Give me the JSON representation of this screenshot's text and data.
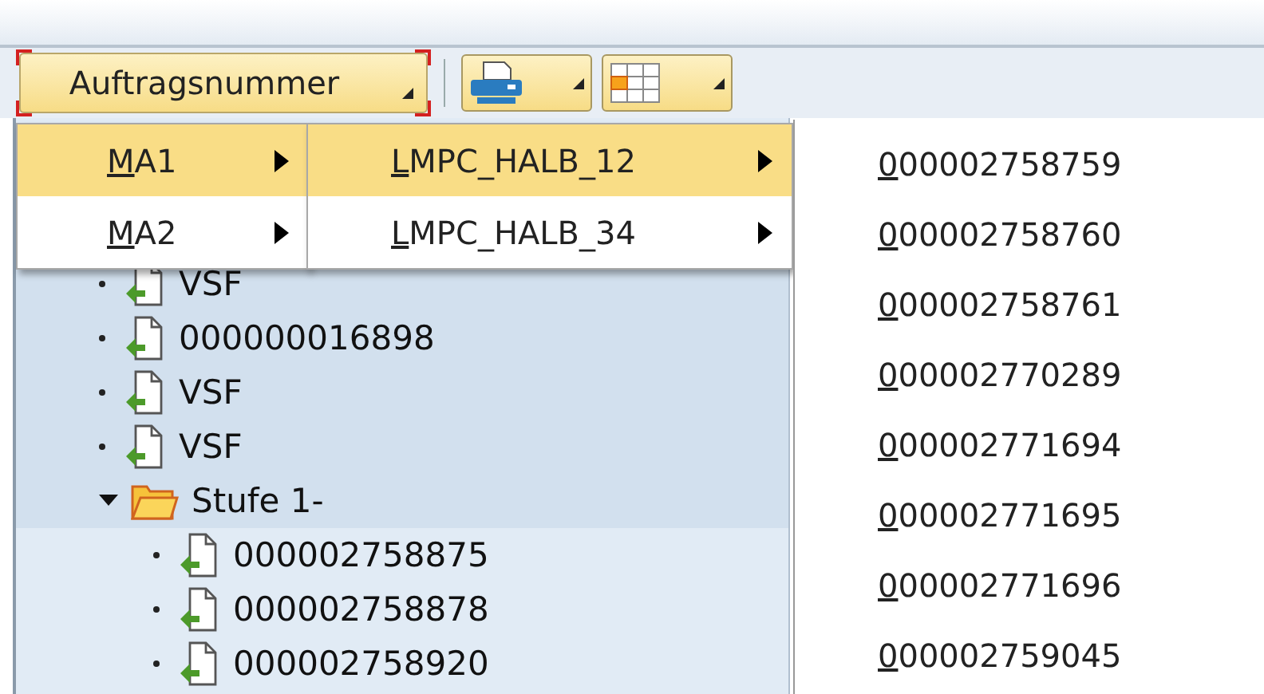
{
  "toolbar": {
    "buttons": [
      {
        "kind": "dropdown",
        "label": "Auftragsnummer",
        "focused": true
      },
      {
        "kind": "print"
      },
      {
        "kind": "layout"
      }
    ]
  },
  "menu": {
    "items": [
      {
        "label": "MA1",
        "selected": true
      },
      {
        "label": "MA2",
        "selected": false
      }
    ]
  },
  "submenu": {
    "items": [
      {
        "label": "LMPC_HALB_12",
        "selected": true
      },
      {
        "label": "LMPC_HALB_34",
        "selected": false
      }
    ]
  },
  "order_list": {
    "items": [
      {
        "label": "000002758759"
      },
      {
        "label": "000002758760"
      },
      {
        "label": "000002758761"
      },
      {
        "label": "000002770289"
      },
      {
        "label": "000002771694"
      },
      {
        "label": "000002771695"
      },
      {
        "label": "000002771696"
      },
      {
        "label": "000002759045"
      }
    ]
  },
  "tree": {
    "items": [
      {
        "kind": "document",
        "label": "VSF",
        "selected": true
      },
      {
        "kind": "document",
        "label": "000000016898",
        "selected": true
      },
      {
        "kind": "document",
        "label": "VSF",
        "selected": true
      },
      {
        "kind": "document",
        "label": "VSF",
        "selected": true
      },
      {
        "kind": "folder",
        "label": "Stufe 1-",
        "selected": true,
        "expanded": true,
        "children": [
          {
            "kind": "document",
            "label": "000002758875",
            "selected": false
          },
          {
            "kind": "document",
            "label": "000002758878",
            "selected": false
          },
          {
            "kind": "document",
            "label": "000002758920",
            "selected": false
          }
        ]
      }
    ]
  }
}
